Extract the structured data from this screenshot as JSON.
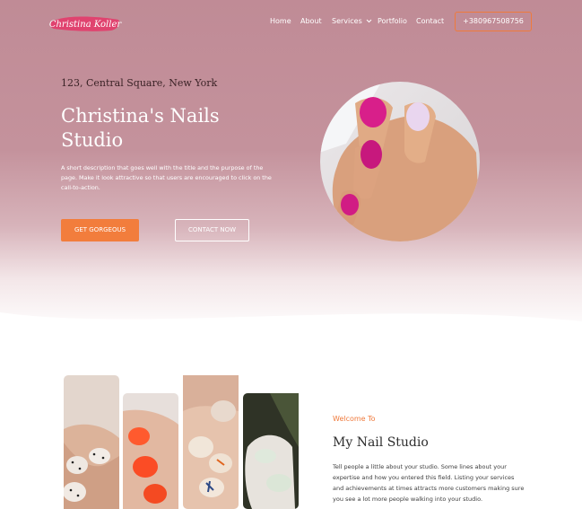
{
  "header": {
    "logo_text": "Christina Koller",
    "nav": [
      "Home",
      "About",
      "Services",
      "Portfolio",
      "Contact"
    ],
    "phone": "+380967508756"
  },
  "hero": {
    "address": "123, Central Square, New York",
    "title": "Christina's Nails Studio",
    "description": "A short description that goes well with the title and the purpose of the page. Make it look attractive so that users are encouraged to click on the call-to-action.",
    "primary_button": "GET GORGEOUS",
    "secondary_button": "CONTACT NOW"
  },
  "about": {
    "kicker": "Welcome To",
    "heading": "My Nail Studio",
    "text": "Tell people a little about your studio. Some lines about your expertise and how you entered this field. Listing your services and achievements at times attracts more customers making sure you see a lot more people walking into your studio."
  },
  "colors": {
    "accent": "#f27d3c",
    "hero_pink": "#c08b96"
  }
}
